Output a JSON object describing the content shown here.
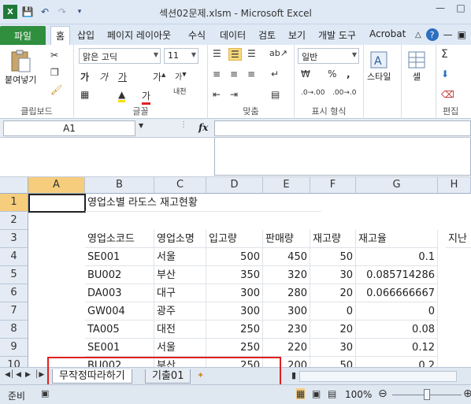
{
  "window": {
    "title": "섹션02문제.xlsm - Microsoft Excel"
  },
  "ribbon": {
    "file_tab": "파일",
    "tabs": [
      "홈",
      "삽입",
      "페이지 레이아웃",
      "수식",
      "데이터",
      "검토",
      "보기",
      "개발 도구",
      "Acrobat"
    ],
    "active_tab": "홈",
    "groups": {
      "clipboard": {
        "label": "클립보드",
        "paste": "붙여넣기"
      },
      "font": {
        "label": "글꼴",
        "name": "맑은 고딕",
        "size": "11"
      },
      "alignment": {
        "label": "맞춤"
      },
      "number": {
        "label": "표시 형식",
        "format": "일반"
      },
      "styles": {
        "label": "스타일"
      },
      "cells": {
        "label": "셀"
      },
      "editing": {
        "label": "편집"
      }
    }
  },
  "formula_bar": {
    "name_box": "A1",
    "fx": "fx",
    "value": ""
  },
  "grid": {
    "columns": [
      "A",
      "B",
      "C",
      "D",
      "E",
      "F",
      "G",
      "H"
    ],
    "rows": [
      "1",
      "2",
      "3",
      "4",
      "5",
      "6",
      "7",
      "8",
      "9",
      "10"
    ],
    "title": "영업소별 라도스 재고현황",
    "headers": [
      "영업소코드",
      "영업소명",
      "입고량",
      "판매량",
      "재고량",
      "재고율",
      "지난"
    ],
    "data": [
      [
        "SE001",
        "서울",
        "500",
        "450",
        "50",
        "0.1"
      ],
      [
        "BU002",
        "부산",
        "350",
        "320",
        "30",
        "0.085714286"
      ],
      [
        "DA003",
        "대구",
        "300",
        "280",
        "20",
        "0.066666667"
      ],
      [
        "GW004",
        "광주",
        "300",
        "300",
        "0",
        "0"
      ],
      [
        "TA005",
        "대전",
        "250",
        "230",
        "20",
        "0.08"
      ],
      [
        "SE001",
        "서울",
        "250",
        "220",
        "30",
        "0.12"
      ],
      [
        "BU002",
        "부산",
        "250",
        "200",
        "50",
        "0.2"
      ]
    ]
  },
  "sheets": {
    "tabs": [
      "무작정따라하기",
      "기출01"
    ],
    "active": "무작정따라하기"
  },
  "status": {
    "ready": "준비",
    "zoom": "100%"
  },
  "colors": {
    "file_tab": "#2f8f3f",
    "highlight_box": "#e02020",
    "selected_header": "#f5cd7c"
  }
}
